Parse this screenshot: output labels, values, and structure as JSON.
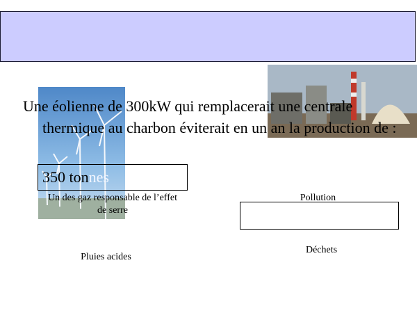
{
  "slide": {
    "main_text": "Une éolienne de 300kW qui remplacerait une centrale thermique au charbon éviterait en un an la production de :",
    "tonnes_number": "350 ton",
    "tonnes_suffix": "nes",
    "labels": {
      "gaz": "Un des gaz responsable de l’effet de serre",
      "pollution": "Pollution",
      "dechets": "Déchets",
      "pluies": "Pluies acides"
    }
  },
  "colors": {
    "title_bar": "#ccccff",
    "sky": "#7fb2e0",
    "plant_sky": "#a9b8c6"
  },
  "images": {
    "left_photo": "wind-turbines-photo",
    "right_photo": "coal-power-plant-photo"
  }
}
